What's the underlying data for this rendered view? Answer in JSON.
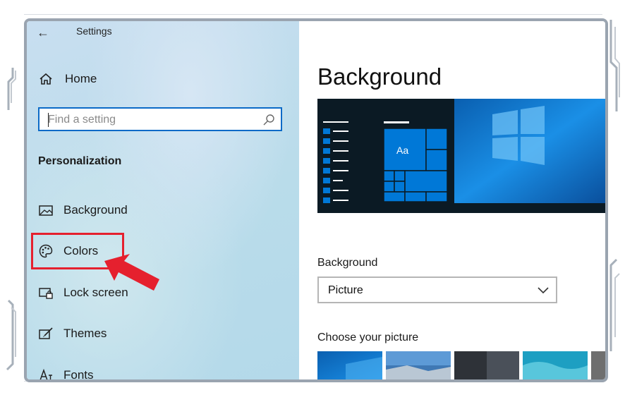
{
  "window": {
    "title": "Settings",
    "back_glyph": "←"
  },
  "sidebar": {
    "home_label": "Home",
    "search_placeholder": "Find a setting",
    "section_title": "Personalization",
    "items": [
      {
        "label": "Background",
        "icon": "picture-icon"
      },
      {
        "label": "Colors",
        "icon": "palette-icon"
      },
      {
        "label": "Lock screen",
        "icon": "lock-screen-icon"
      },
      {
        "label": "Themes",
        "icon": "themes-icon"
      },
      {
        "label": "Fonts",
        "icon": "fonts-icon"
      }
    ]
  },
  "main": {
    "page_title": "Background",
    "preview_tile_text": "Aa",
    "background_label": "Background",
    "background_value": "Picture",
    "choose_picture_label": "Choose your picture"
  },
  "colors": {
    "accent": "#0b6ac7",
    "highlight": "#e5202e",
    "preview_blue": "#0078d7",
    "preview_dark": "#0b1a24"
  }
}
